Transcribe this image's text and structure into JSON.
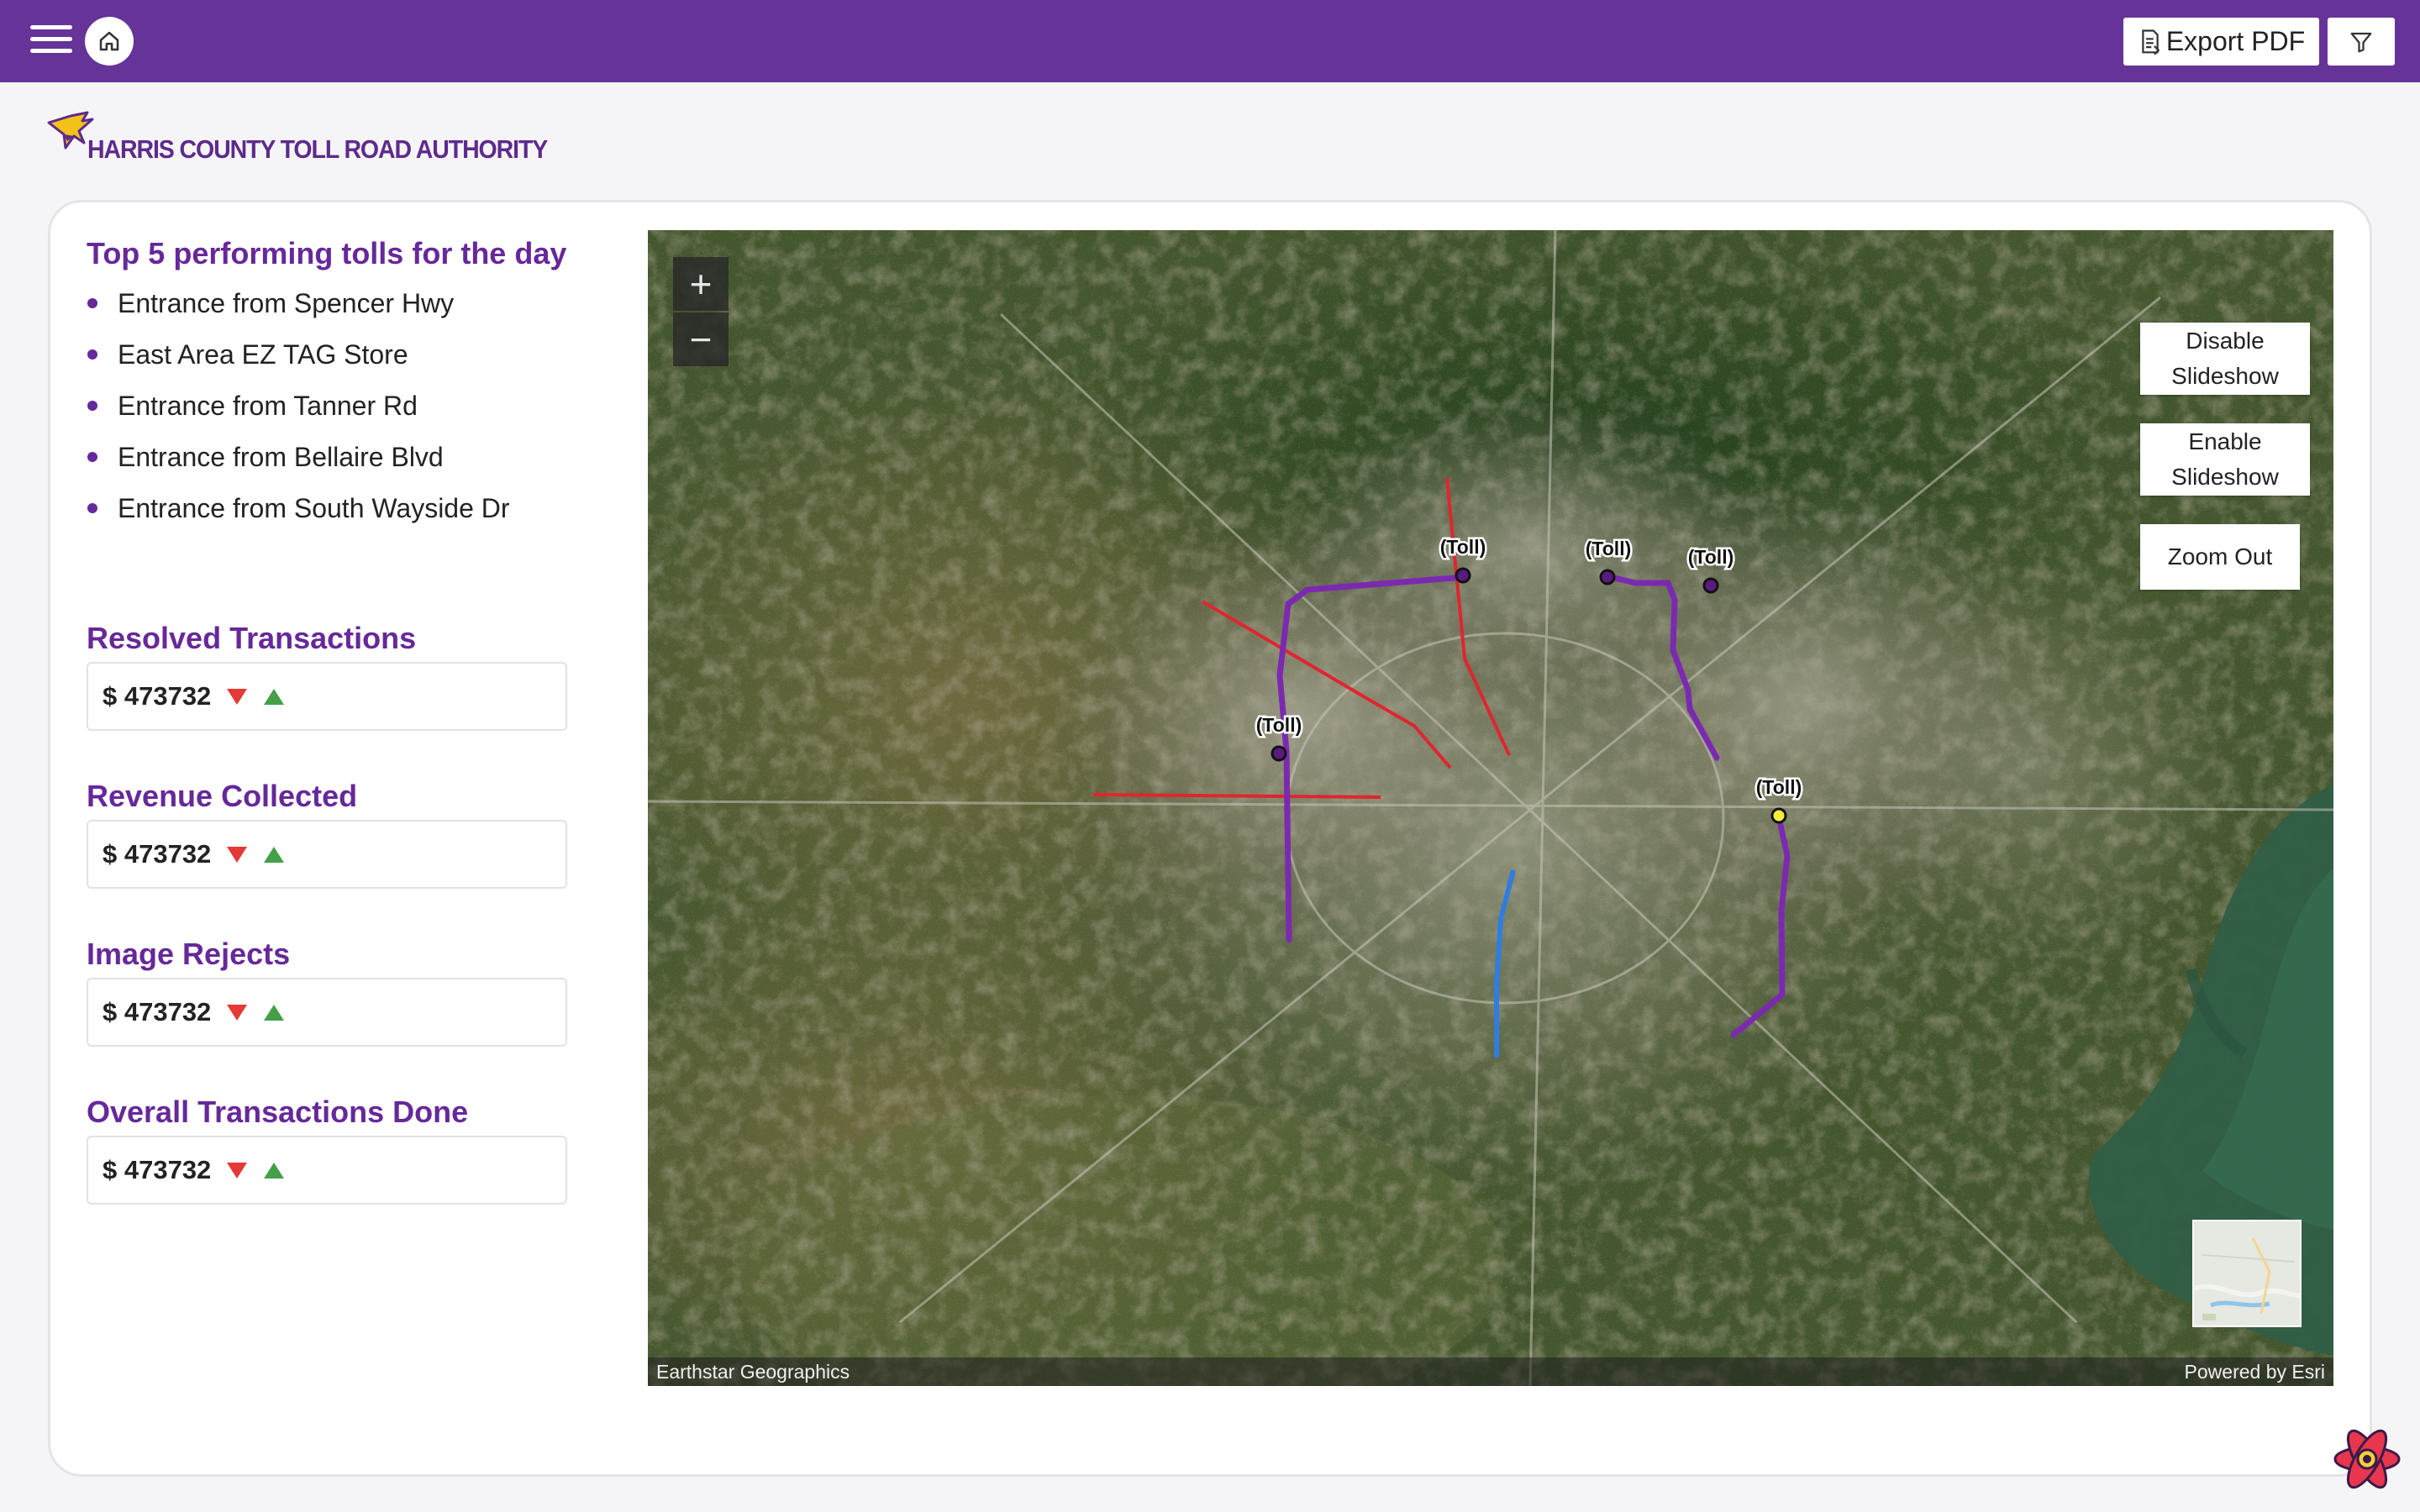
{
  "header": {
    "menu_icon": "hamburger-menu-icon",
    "home_icon": "home-icon",
    "export_label": "Export PDF",
    "export_icon": "document-export-icon",
    "filter_icon": "filter-icon",
    "bar_color": "#663399"
  },
  "logo": {
    "text": "HARRIS COUNTY TOLL ROAD AUTHORITY"
  },
  "top5": {
    "title": "Top 5 performing tolls for the day",
    "items": [
      "Entrance from Spencer Hwy",
      "East Area EZ TAG Store",
      "Entrance from Tanner Rd",
      "Entrance from Bellaire Blvd",
      "Entrance from South Wayside Dr"
    ]
  },
  "metrics": [
    {
      "title": "Resolved Transactions",
      "value": "$ 473732"
    },
    {
      "title": "Revenue Collected",
      "value": "$ 473732"
    },
    {
      "title": "Image Rejects",
      "value": "$ 473732"
    },
    {
      "title": "Overall Transactions Done",
      "value": "$ 473732"
    }
  ],
  "map": {
    "zoom_in": "+",
    "zoom_out": "−",
    "disable_slideshow": "Disable Slideshow",
    "enable_slideshow": "Enable Slideshow",
    "zoom_out_button": "Zoom Out",
    "attribution_left": "Earthstar Geographics",
    "attribution_right": "Powered by Esri",
    "toll_markers": [
      "(Toll)",
      "(Toll)",
      "(Toll)",
      "(Toll)",
      "(Toll)"
    ],
    "route_colors": {
      "toll_road": "#7b2ab0",
      "red_route": "#e0252e",
      "blue_route": "#2f7de0",
      "selected_marker": "#f4ee3a"
    }
  },
  "accent_color": "#66289a"
}
